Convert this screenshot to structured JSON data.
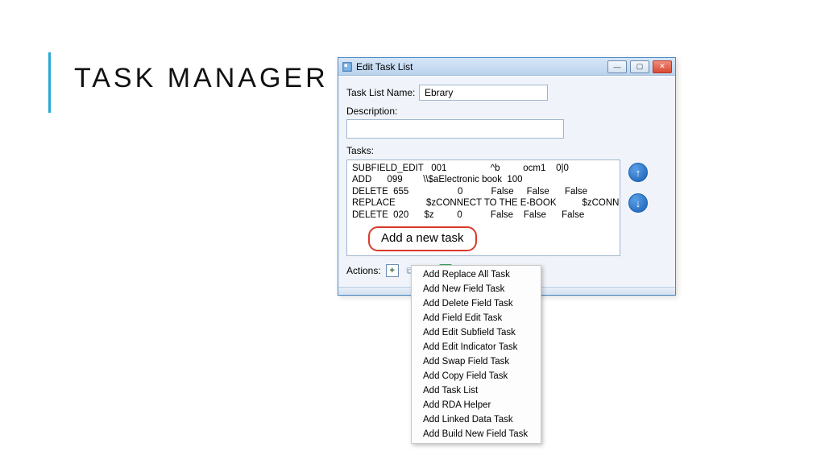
{
  "slide": {
    "title": "TASK MANAGER"
  },
  "window": {
    "title": "Edit Task List",
    "labels": {
      "task_list_name": "Task List Name:",
      "description": "Description:",
      "tasks": "Tasks:",
      "actions": "Actions:"
    },
    "task_list_name_value": "Ebrary",
    "description_value": "",
    "tasks_rows": [
      "SUBFIELD_EDIT   001                 ^b         ocm1    0|0",
      "ADD      099        \\\\$aElectronic book  100",
      "DELETE  655                   0           False     False      False",
      "REPLACE            $zCONNECT TO THE E-BOOK          $zCONNECT",
      "DELETE  020      $z         0           False    False      False"
    ],
    "callout": "Add a new task"
  },
  "buttons": {
    "minimize": "—",
    "maximize": "▢",
    "close": "✕",
    "up": "↑",
    "down": "↓",
    "plus": "+",
    "copy": "⧉",
    "delete": "✕",
    "save": "✓"
  },
  "menu": {
    "items": [
      "Add Replace All Task",
      "Add New Field Task",
      "Add Delete Field Task",
      "Add Field Edit Task",
      "Add Edit Subfield Task",
      "Add Edit Indicator Task",
      "Add Swap Field Task",
      "Add Copy Field Task",
      "Add Task List",
      "Add RDA Helper",
      "Add Linked Data Task",
      "Add Build New Field Task"
    ]
  }
}
